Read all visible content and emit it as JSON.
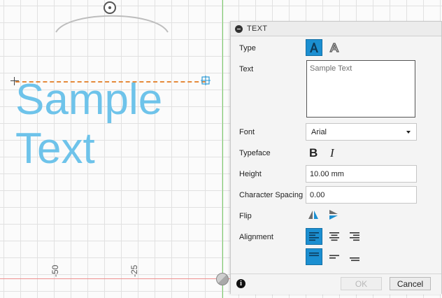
{
  "canvas": {
    "sample_text_line1": "Sample",
    "sample_text_line2": "Text",
    "ruler_labels": [
      "-50",
      "-25"
    ]
  },
  "dialog": {
    "title": "TEXT",
    "labels": {
      "type": "Type",
      "text": "Text",
      "font": "Font",
      "typeface": "Typeface",
      "height": "Height",
      "character_spacing": "Character Spacing",
      "flip": "Flip",
      "alignment": "Alignment"
    },
    "type_options": {
      "selected": "A (text on path off)",
      "alt": "A (text on path)"
    },
    "text_placeholder": "Sample Text",
    "font": {
      "selected": "Arial"
    },
    "typeface": {
      "bold_glyph": "B",
      "italic_glyph": "I"
    },
    "height_value": "10.00 mm",
    "character_spacing_value": "0.00",
    "buttons": {
      "ok": "OK",
      "cancel": "Cancel"
    }
  },
  "colors": {
    "accent": "#1b8fd1",
    "sample_text": "#6ec3ea",
    "green_axis": "#7ccf6a",
    "red_axis": "#ef8f8f",
    "baseline": "#e58a3a"
  }
}
